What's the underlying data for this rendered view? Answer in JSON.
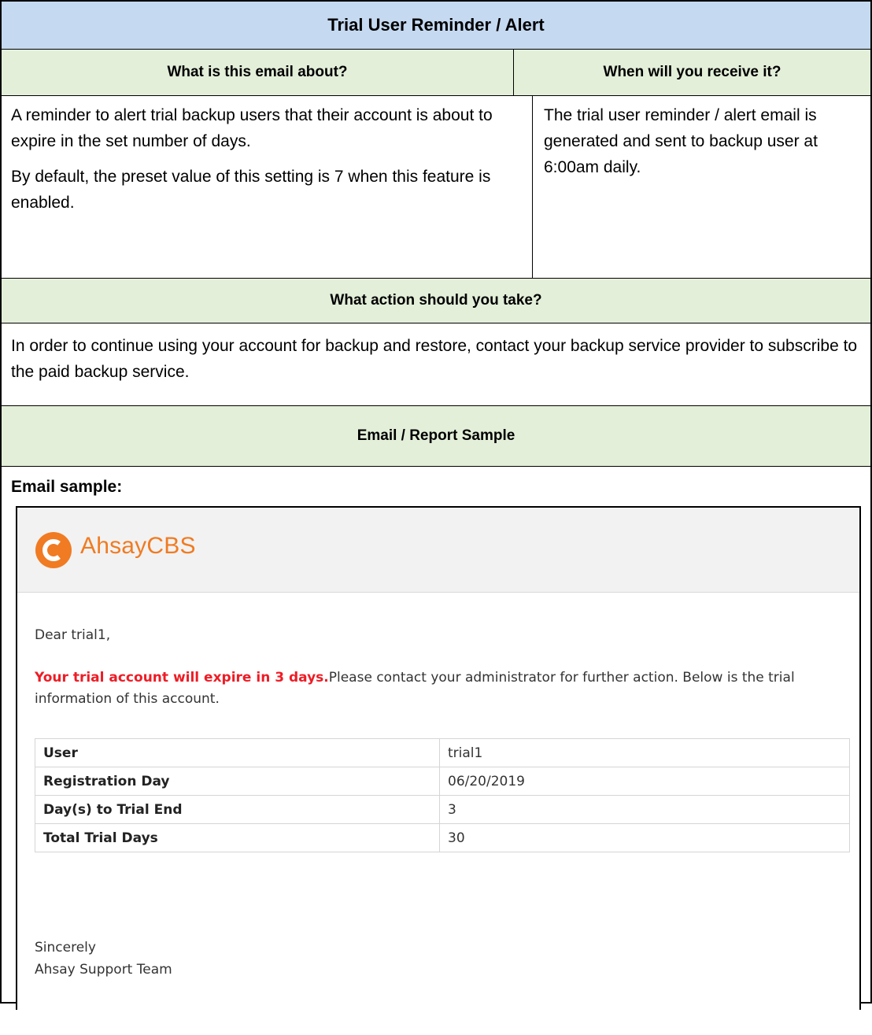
{
  "title": "Trial User Reminder / Alert",
  "headers": {
    "about": "What is this email about?",
    "when": "When will you receive it?",
    "action": "What action should you take?",
    "sample": "Email / Report Sample"
  },
  "about_text": {
    "p1": "A reminder to alert trial backup users that their account is about to expire in the set number of days.",
    "p2": "By default, the preset value of this setting is 7 when this feature is enabled."
  },
  "when_text": "The trial user reminder / alert email is generated and sent to backup user at 6:00am daily.",
  "action_text": "In order to continue using your account for backup and restore, contact your backup service provider to subscribe to the paid backup service.",
  "sample_label": "Email sample:",
  "email": {
    "brand": "AhsayCBS",
    "brand_color": "#f07b22",
    "greeting": "Dear trial1,",
    "alert": "Your trial account will expire in 3 days.",
    "message": "Please contact your administrator for further action. Below is the trial information of this account.",
    "alert_color": "#ee1c25",
    "rows": [
      {
        "label": "User",
        "value": "trial1"
      },
      {
        "label": "Registration Day",
        "value": "06/20/2019"
      },
      {
        "label": "Day(s) to Trial End",
        "value": "3"
      },
      {
        "label": "Total Trial Days",
        "value": "30"
      }
    ],
    "signoff": "Sincerely",
    "team": "Ahsay Support Team"
  }
}
